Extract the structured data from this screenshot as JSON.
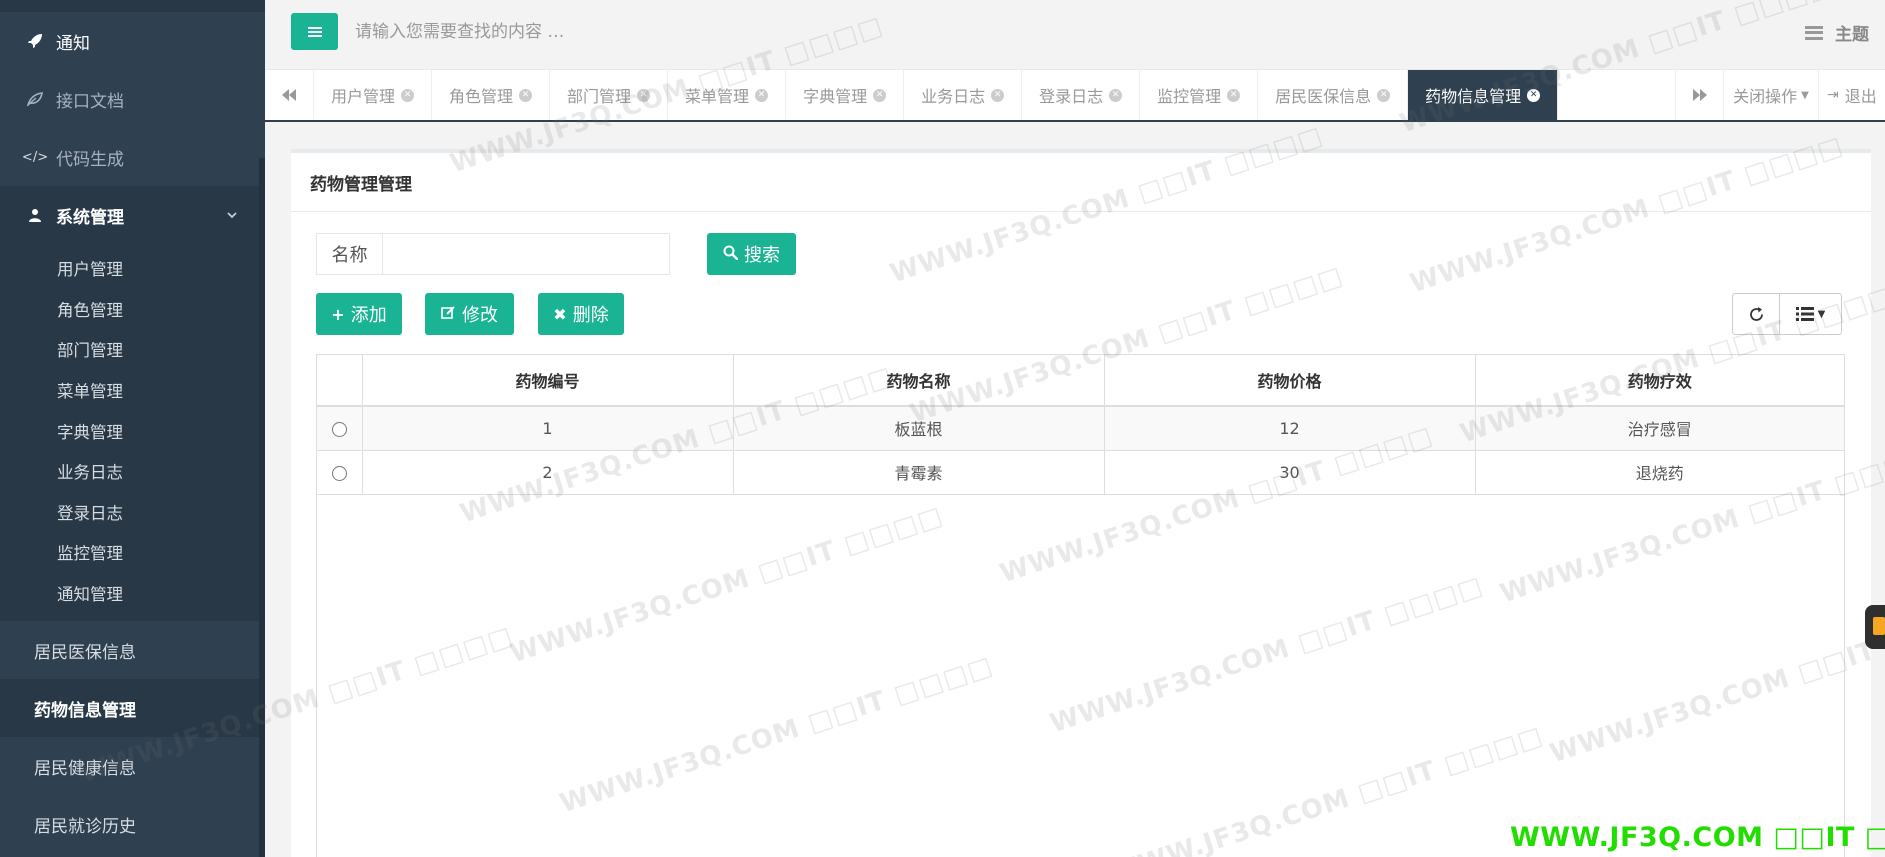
{
  "sidebar": {
    "items_top": [
      {
        "label": "通知",
        "icon": "rocket-icon"
      },
      {
        "label": "接口文档",
        "icon": "leaf-icon"
      },
      {
        "label": "代码生成",
        "icon": "code-icon"
      }
    ],
    "group": {
      "label": "系统管理",
      "icon": "user-icon"
    },
    "sub_items": [
      "用户管理",
      "角色管理",
      "部门管理",
      "菜单管理",
      "字典管理",
      "业务日志",
      "登录日志",
      "监控管理",
      "通知管理"
    ],
    "items_bottom": [
      "居民医保信息",
      "药物信息管理",
      "居民健康信息",
      "居民就诊历史"
    ]
  },
  "header": {
    "search_placeholder": "请输入您需要查找的内容 …",
    "theme_label": "主题"
  },
  "tabs": [
    "用户管理",
    "角色管理",
    "部门管理",
    "菜单管理",
    "字典管理",
    "业务日志",
    "登录日志",
    "监控管理",
    "居民医保信息",
    "药物信息管理"
  ],
  "tab_actions": {
    "close_ops": "关闭操作",
    "logout": "退出"
  },
  "panel": {
    "title": "药物管理管理",
    "search_label": "名称",
    "search_value": "",
    "search_button": "搜索",
    "add_button": "添加",
    "edit_button": "修改",
    "delete_button": "删除"
  },
  "table": {
    "columns": [
      "药物编号",
      "药物名称",
      "药物价格",
      "药物疗效"
    ],
    "rows": [
      [
        "1",
        "板蓝根",
        "12",
        "治疗感冒"
      ],
      [
        "2",
        "青霉素",
        "30",
        "退烧药"
      ]
    ]
  },
  "watermark": {
    "text": "WWW.JF3Q.COM □□IT □□□□",
    "corner_text": "WWW.JF3Q.COM □□IT □□□□"
  },
  "colors": {
    "primary": "#1ab394",
    "sidebar": "#2f4050",
    "sidebar_dark": "#293846",
    "corner_watermark": "#22dd00"
  }
}
